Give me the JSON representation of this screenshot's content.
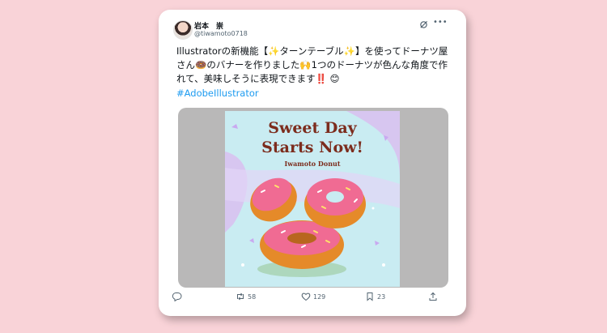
{
  "tweet": {
    "author_name": "岩本　崇",
    "author_handle": "@tiwamoto0718",
    "text": "Illustratorの新機能【✨ターンテーブル✨】を使ってドーナツ屋さん🍩のバナーを作りました🙌1つのドーナツが色んな角度で作れて、美味しそうに表現できます‼️ 😊",
    "hashtag": "#AdobeIllustrator"
  },
  "media": {
    "banner_title_line1": "Sweet Day",
    "banner_title_line2": "Starts Now!",
    "banner_subtitle": "Iwamoto Donut"
  },
  "actions": {
    "retweet_count": "58",
    "like_count": "129",
    "bookmark_count": "23"
  },
  "icons": {
    "header": [
      "grok-icon",
      "more-icon"
    ],
    "action_bar": [
      "reply-icon",
      "retweet-icon",
      "like-icon",
      "bookmark-icon",
      "share-icon"
    ]
  },
  "colors": {
    "background": "#f9d3d8",
    "hashtag": "#1d9bf0",
    "banner_text": "#7c2c1d",
    "banner_bg": "#c9ecf2",
    "icing": "#f06b93",
    "dough": "#e58a29"
  }
}
